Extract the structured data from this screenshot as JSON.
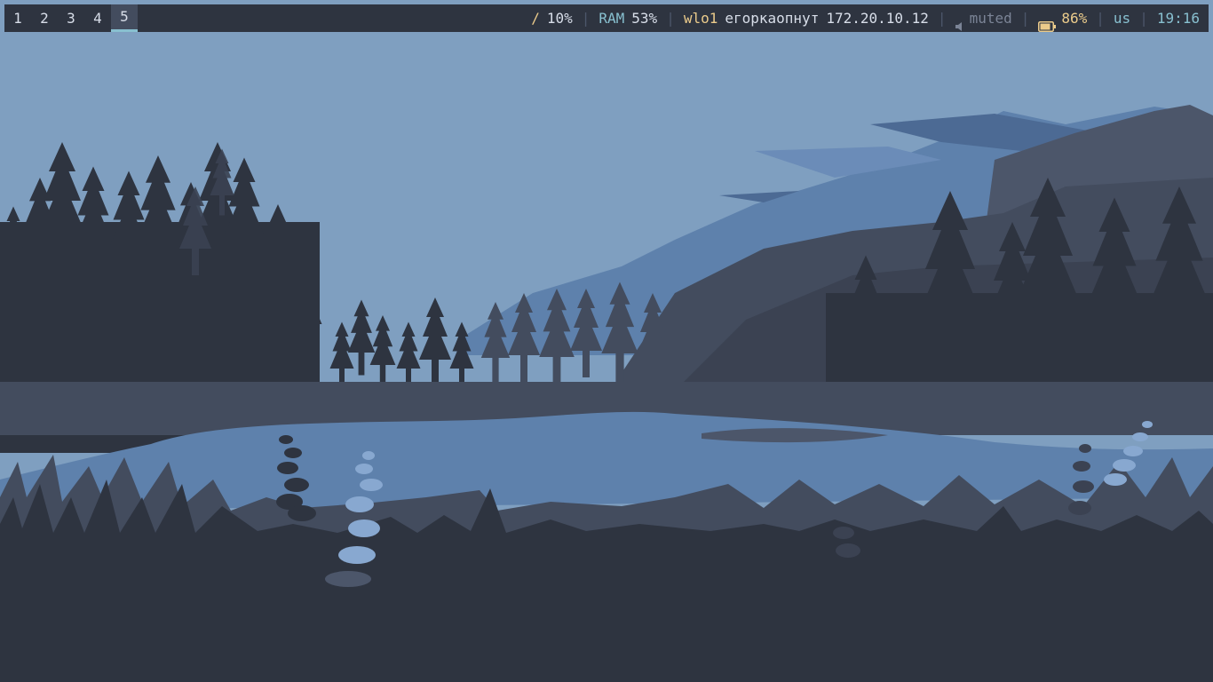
{
  "workspaces": [
    {
      "label": "1",
      "active": false
    },
    {
      "label": "2",
      "active": false
    },
    {
      "label": "3",
      "active": false
    },
    {
      "label": "4",
      "active": false
    },
    {
      "label": "5",
      "active": true
    }
  ],
  "status": {
    "disk": {
      "mount": "/",
      "usage": "10%"
    },
    "memory": {
      "label": "RAM",
      "usage": "53%"
    },
    "network": {
      "interface": "wlo1",
      "ssid": "егоркаопнут",
      "ip": "172.20.10.12"
    },
    "volume": {
      "icon": "speaker-icon",
      "state": "muted"
    },
    "battery": {
      "icon": "battery-icon",
      "level": "86%"
    },
    "keyboard_layout": "us",
    "clock": "19:16"
  },
  "colors": {
    "bar_bg": "#2e3440",
    "fg": "#d8dee9",
    "accent_yellow": "#ebcb8b",
    "accent_cyan": "#88c0d0",
    "separator": "#4c566a",
    "sky": "#7f9fc0",
    "forest_dark": "#2e3440"
  },
  "wallpaper": {
    "subject": "forest-lake-landscape"
  }
}
